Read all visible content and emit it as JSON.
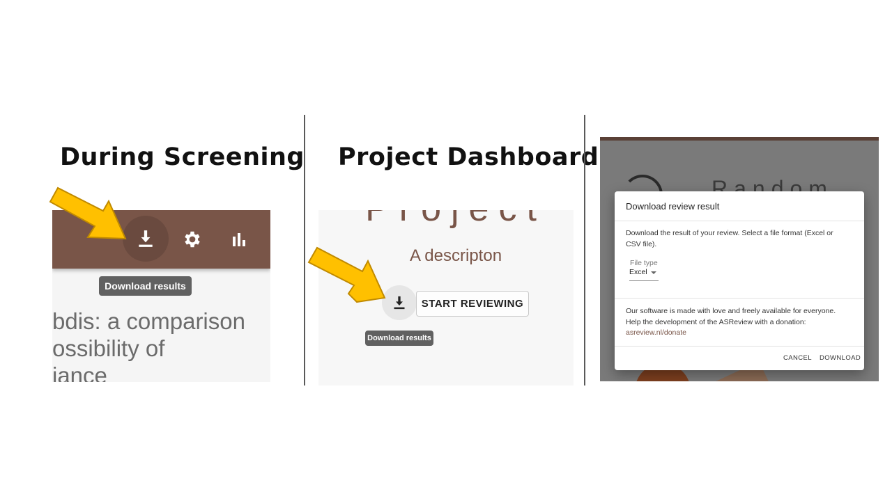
{
  "headings": {
    "left": "During Screening",
    "middle": "Project Dashboard"
  },
  "panel_screening": {
    "toolbar_icons": [
      "download-icon",
      "gear-icon",
      "stats-icon"
    ],
    "tooltip": "Download results",
    "title_text": "bdis: a comparison\nossibility of\niance"
  },
  "panel_dashboard": {
    "project_title": "Project",
    "description": "A descripton",
    "start_button": "START REVIEWING",
    "tooltip": "Download results"
  },
  "panel_dialog": {
    "background_title": "Random",
    "title": "Download review result",
    "body": "Download the result of your review. Select a file format (Excel or CSV file).",
    "file_type_label": "File type",
    "file_type_value": "Excel",
    "support_text": "Our software is made with love and freely available for everyone. Help the development of the ASReview with a donation:",
    "donate_link": "asreview.nl/donate",
    "cancel": "CANCEL",
    "download": "DOWNLOAD"
  },
  "colors": {
    "brand_brown": "#795548",
    "arrow_yellow": "#FFC000",
    "tooltip_grey": "#616161"
  }
}
